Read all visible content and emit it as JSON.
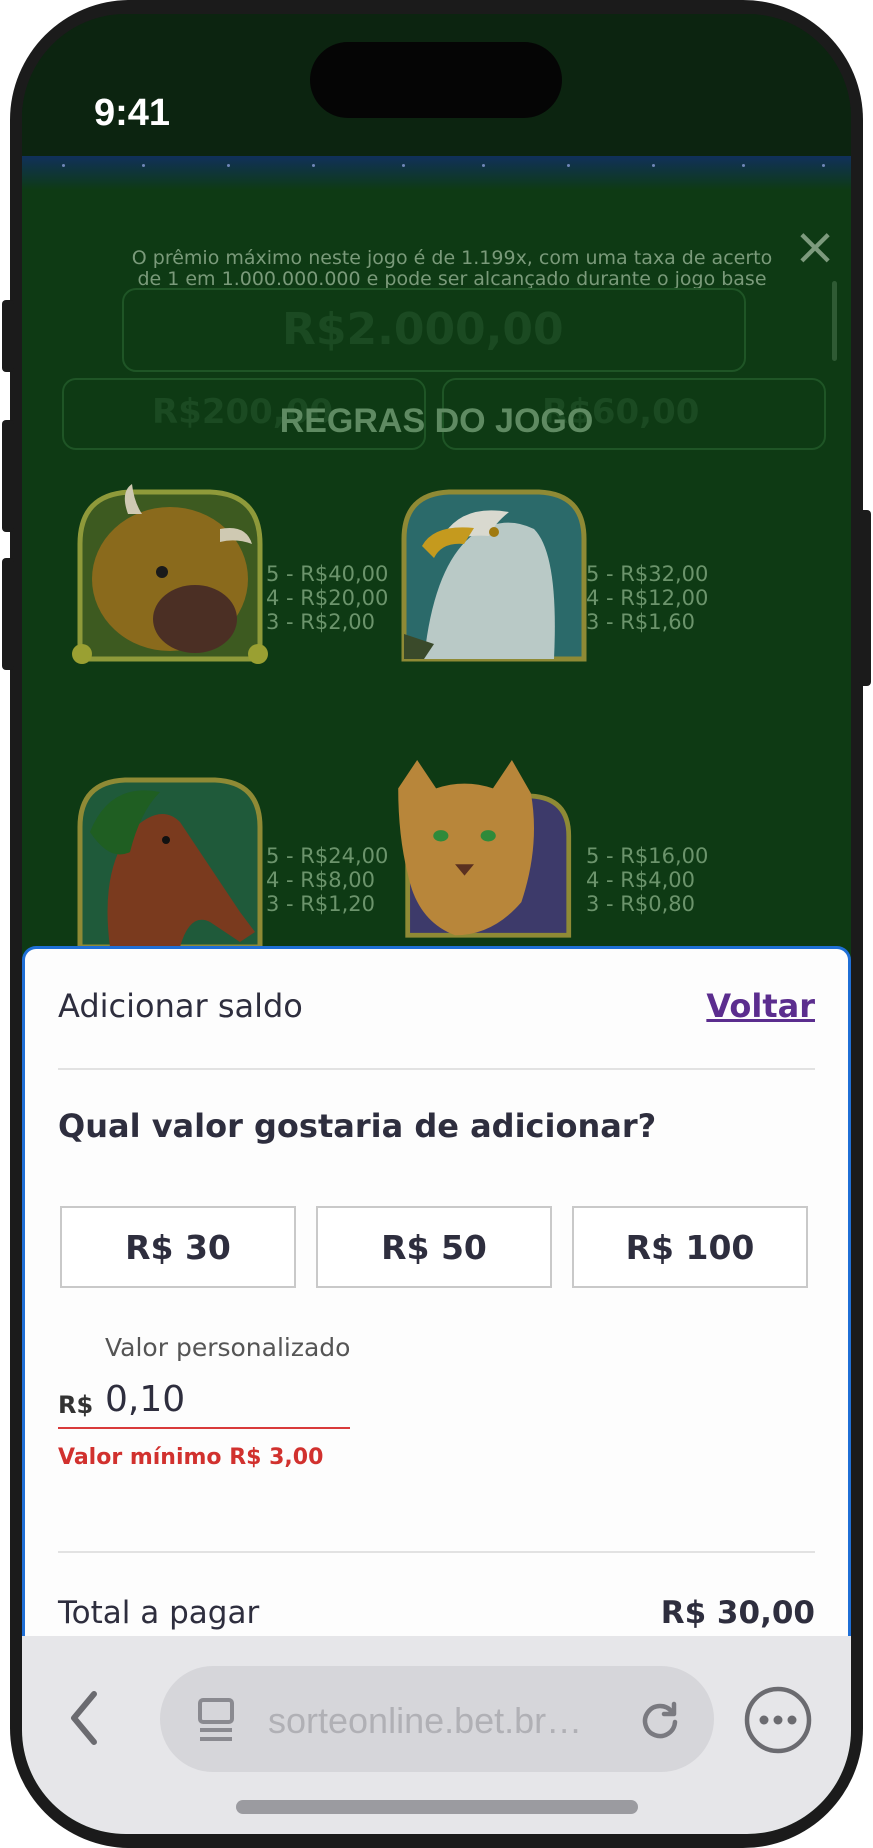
{
  "status_bar": {
    "time": "9:41"
  },
  "game": {
    "prize_note_line1": "O prêmio máximo neste jogo é de 1.199x, com uma taxa de acerto",
    "prize_note_line2": "de 1 em 1.000.000.000 e pode ser alcançado durante o jogo base",
    "faded_jackpot": "R$2.000,00",
    "faded_left": "R$200,00",
    "faded_right": "R$60,00",
    "rules_title": "REGRAS DO JOGO",
    "symbols": [
      {
        "name": "bison",
        "lines": [
          "5 - R$40,00",
          "4 - R$20,00",
          "3 - R$2,00"
        ]
      },
      {
        "name": "eagle",
        "lines": [
          "5 - R$32,00",
          "4 - R$12,00",
          "3 - R$1,60"
        ]
      },
      {
        "name": "horse",
        "lines": [
          "5 - R$24,00",
          "4 - R$8,00",
          "3 - R$1,20"
        ]
      },
      {
        "name": "cougar",
        "lines": [
          "5 - R$16,00",
          "4 - R$4,00",
          "3 - R$0,80"
        ]
      }
    ]
  },
  "sheet": {
    "title": "Adicionar saldo",
    "back_label": "Voltar",
    "question": "Qual valor gostaria de adicionar?",
    "amounts": [
      "R$ 30",
      "R$ 50",
      "R$ 100"
    ],
    "custom_label": "Valor personalizado",
    "currency": "R$",
    "custom_value": "0,10",
    "error": "Valor mínimo R$ 3,00",
    "total_label": "Total a pagar",
    "total_value": "R$ 30,00"
  },
  "browser": {
    "url": "sorteonline.bet.br…"
  },
  "colors": {
    "accent_link": "#5b2d8e",
    "error": "#d1312e",
    "sheet_border": "#1f6fd6"
  }
}
